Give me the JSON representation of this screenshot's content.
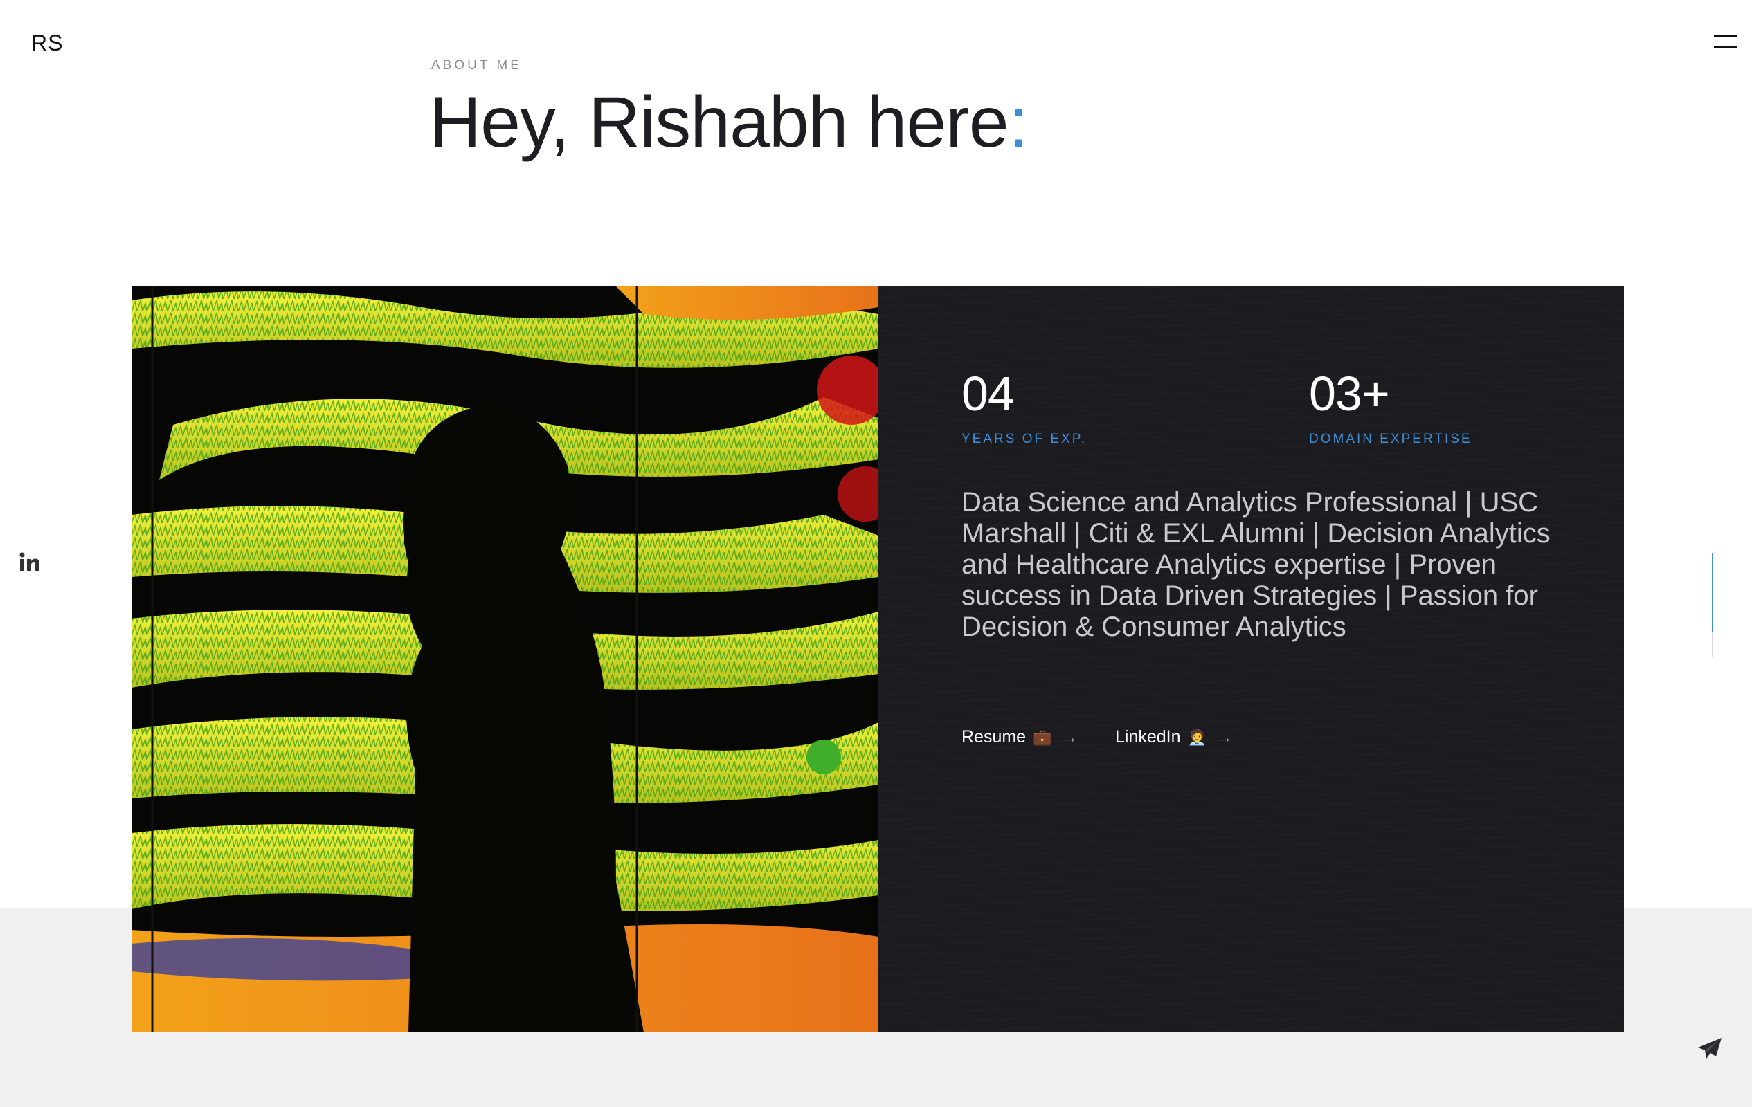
{
  "header": {
    "logo": "RS",
    "menu_icon": "hamburger-menu-icon"
  },
  "about": {
    "section_label": "ABOUT ME",
    "title": "Hey, Rishabh here",
    "title_accent": ":"
  },
  "stats": [
    {
      "value": "04",
      "label": "YEARS OF EXP."
    },
    {
      "value": "03+",
      "label": "DOMAIN EXPERTISE"
    }
  ],
  "bio": "Data Science and Analytics Professional | USC Marshall | Citi & EXL Alumni | Decision Analytics and Healthcare Analytics expertise | Proven success in Data Driven Strategies | Passion for Decision & Consumer Analytics",
  "links": [
    {
      "label": "Resume",
      "emoji": "💼",
      "arrow": "→"
    },
    {
      "label": "LinkedIn",
      "emoji": "🧑‍💼",
      "arrow": "→"
    }
  ],
  "social": {
    "linkedin_icon": "linkedin-icon"
  },
  "scroll": {
    "progress": 0.75
  },
  "footer": {
    "send_icon": "paper-plane-icon"
  },
  "colors": {
    "accent": "#3a8fd8",
    "panel_bg": "#1b1b20",
    "band_bg": "#f0f0f0",
    "text_dark": "#1d1d22"
  }
}
